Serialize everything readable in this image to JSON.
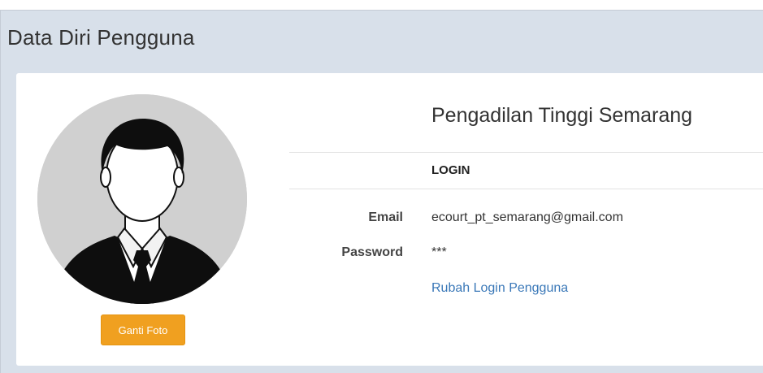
{
  "page": {
    "title": "Data Diri Pengguna"
  },
  "profile": {
    "avatar_icon": "user-silhouette-icon",
    "change_photo_label": "Ganti Foto",
    "organization": "Pengadilan Tinggi Semarang"
  },
  "login": {
    "heading": "LOGIN",
    "email_label": "Email",
    "email_value": "ecourt_pt_semarang@gmail.com",
    "password_label": "Password",
    "password_value": "***",
    "change_login_link": "Rubah Login Pengguna"
  },
  "colors": {
    "background": "#d8e0ea",
    "button": "#f0a020",
    "link": "#3a78b8"
  }
}
